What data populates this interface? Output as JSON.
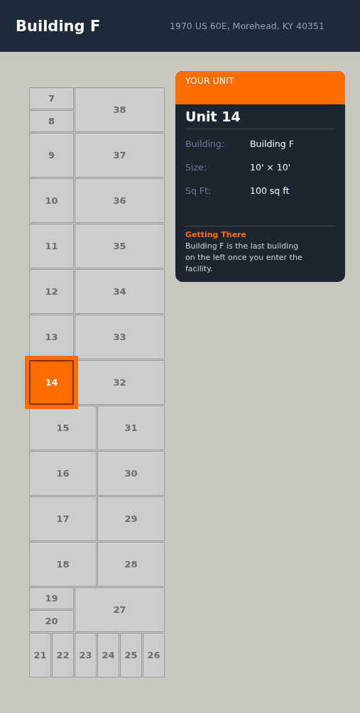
{
  "header": {
    "title": "Building F",
    "address": "1970 US 60E, Morehead, KY 40351"
  },
  "units": [
    {
      "label": "7",
      "selected": false
    },
    {
      "label": "38",
      "selected": false
    },
    {
      "label": "8",
      "selected": false
    },
    {
      "label": "9",
      "selected": false
    },
    {
      "label": "37",
      "selected": false
    },
    {
      "label": "10",
      "selected": false
    },
    {
      "label": "36",
      "selected": false
    },
    {
      "label": "11",
      "selected": false
    },
    {
      "label": "35",
      "selected": false
    },
    {
      "label": "12",
      "selected": false
    },
    {
      "label": "34",
      "selected": false
    },
    {
      "label": "13",
      "selected": false
    },
    {
      "label": "33",
      "selected": false
    },
    {
      "label": "14",
      "selected": true
    },
    {
      "label": "32",
      "selected": false
    },
    {
      "label": "15",
      "selected": false
    },
    {
      "label": "31",
      "selected": false
    },
    {
      "label": "16",
      "selected": false
    },
    {
      "label": "30",
      "selected": false
    },
    {
      "label": "17",
      "selected": false
    },
    {
      "label": "29",
      "selected": false
    },
    {
      "label": "18",
      "selected": false
    },
    {
      "label": "28",
      "selected": false
    },
    {
      "label": "19",
      "selected": false
    },
    {
      "label": "27",
      "selected": false
    },
    {
      "label": "20",
      "selected": false
    },
    {
      "label": "21",
      "selected": false
    },
    {
      "label": "22",
      "selected": false
    },
    {
      "label": "23",
      "selected": false
    },
    {
      "label": "24",
      "selected": false
    },
    {
      "label": "25",
      "selected": false
    },
    {
      "label": "26",
      "selected": false
    }
  ],
  "card": {
    "eyebrow": "YOUR UNIT",
    "title": "Unit 14",
    "details": [
      {
        "label": "Building:",
        "value": "Building F"
      },
      {
        "label": "Size:",
        "value": "10' × 10'"
      },
      {
        "label": "Sq Ft:",
        "value": "100 sq ft"
      }
    ],
    "directions_title": "Getting There",
    "directions": "Building F is the last building on the left once you enter the facility."
  }
}
